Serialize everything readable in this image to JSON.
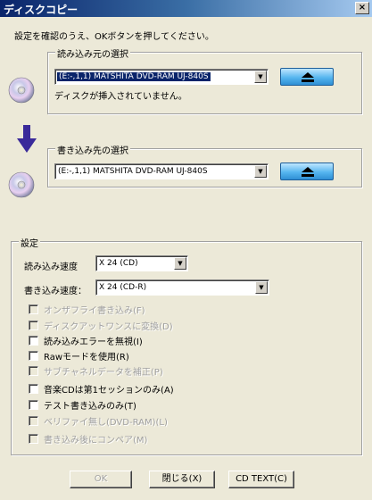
{
  "window": {
    "title": "ディスクコピー",
    "close_glyph": "×"
  },
  "instruction": "設定を確認のうえ、OKボタンを押してください。",
  "source": {
    "group_label": "読み込み元の選択",
    "drive": "(E:-,1,1) MATSHITA DVD-RAM UJ-840S",
    "status": "ディスクが挿入されていません。"
  },
  "destination": {
    "group_label": "書き込み先の選択",
    "drive": "(E:-,1,1) MATSHITA DVD-RAM UJ-840S"
  },
  "settings": {
    "group_label": "設定",
    "read_speed_label": "読み込み速度",
    "read_speed_value": "X 24 (CD)",
    "write_speed_label": "書き込み速度：",
    "write_speed_value": "X 24 (CD-R)",
    "options": [
      {
        "label": "オンザフライ書き込み(F)",
        "enabled": false
      },
      {
        "label": "ディスクアットワンスに変換(D)",
        "enabled": false
      },
      {
        "label": "読み込みエラーを無視(I)",
        "enabled": true
      },
      {
        "label": "Rawモードを使用(R)",
        "enabled": true
      },
      {
        "label": "サブチャネルデータを補正(P)",
        "enabled": false
      },
      {
        "label": "音楽CDは第1セッションのみ(A)",
        "enabled": true
      },
      {
        "label": "テスト書き込みのみ(T)",
        "enabled": true
      },
      {
        "label": "ベリファイ無し(DVD-RAM)(L)",
        "enabled": false
      },
      {
        "label": "書き込み後にコンペア(M)",
        "enabled": false
      }
    ]
  },
  "buttons": {
    "ok": "OK",
    "close": "閉じる(X)",
    "cd_text": "CD TEXT(C)"
  }
}
